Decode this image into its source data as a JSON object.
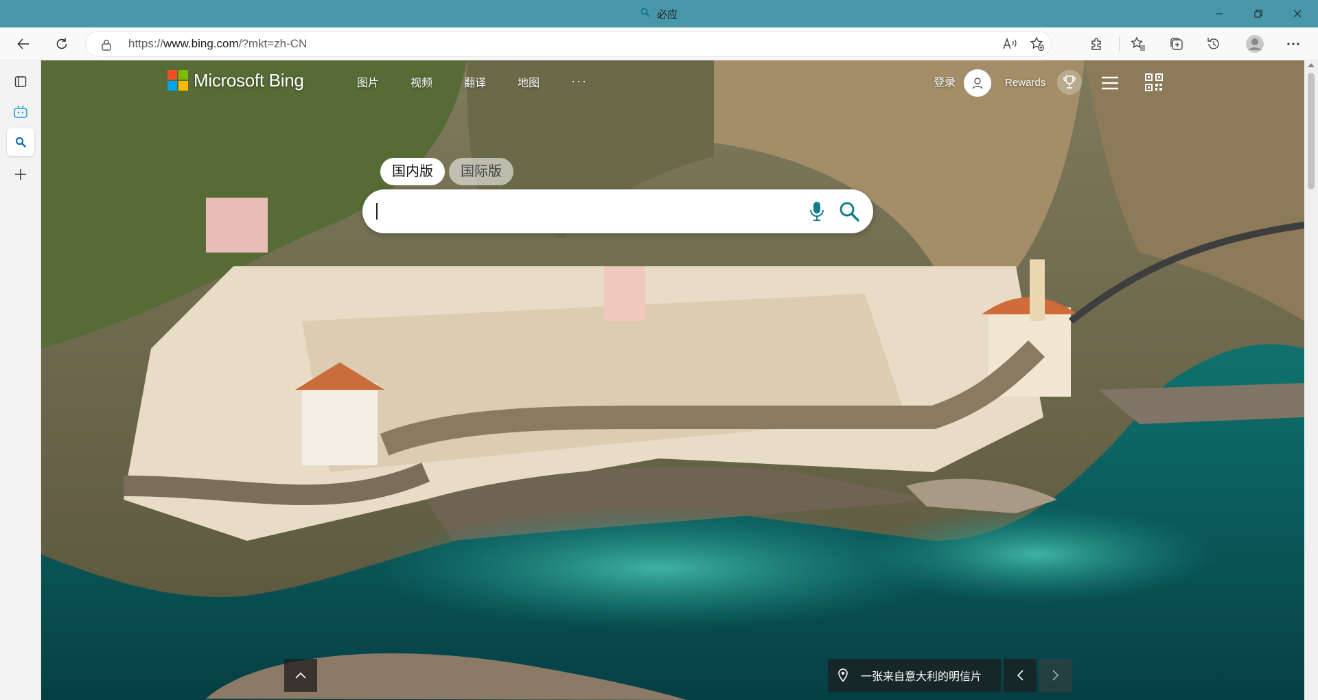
{
  "window": {
    "title": "必应"
  },
  "toolbar": {
    "url_prefix": "https://",
    "url_host": "www.bing.com",
    "url_rest": "/?mkt=zh-CN"
  },
  "header": {
    "logo_text": "Microsoft Bing",
    "nav": [
      "图片",
      "视频",
      "翻译",
      "地图"
    ],
    "more": "···",
    "login": "登录",
    "rewards": "Rewards"
  },
  "scope": {
    "domestic": "国内版",
    "international": "国际版"
  },
  "search": {
    "placeholder": ""
  },
  "caption": {
    "text": "一张来自意大利的明信片"
  },
  "colors": {
    "titlebar": "#4797a8",
    "bing_accent": "#107c8c",
    "ms_red": "#f25022",
    "ms_green": "#7fba00",
    "ms_blue": "#00a4ef",
    "ms_yellow": "#ffb900"
  }
}
